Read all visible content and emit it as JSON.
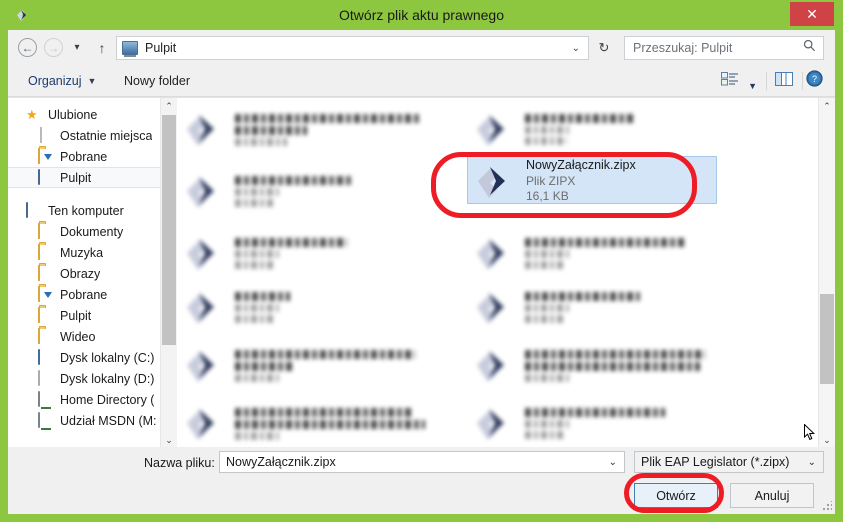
{
  "window": {
    "title": "Otwórz plik aktu prawnego",
    "app_icon": "chevron-logo-icon",
    "close_label": "✕",
    "frame_color": "#8dc63f",
    "close_color": "#cf4245"
  },
  "address_bar": {
    "back_glyph": "←",
    "forward_glyph": "→",
    "history_glyph": "▾",
    "up_glyph": "↑",
    "path": "Pulpit",
    "dropdown_glyph": "⌄",
    "refresh_glyph": "↻"
  },
  "search": {
    "placeholder": "Przeszukaj: Pulpit",
    "icon": "search-icon"
  },
  "toolbar": {
    "organize_label": "Organizuj",
    "organize_caret": "▼",
    "new_folder_label": "Nowy folder",
    "view_icon": "view-options-icon",
    "view_caret": "▼",
    "preview_pane_icon": "preview-pane-icon",
    "help_icon": "help-icon"
  },
  "sidebar": {
    "groups": [
      {
        "header": "Ulubione",
        "header_icon": "star-icon",
        "items": [
          {
            "label": "Ostatnie miejsca",
            "icon": "recent-places-icon",
            "selected": false
          },
          {
            "label": "Pobrane",
            "icon": "downloads-folder-icon",
            "selected": false
          },
          {
            "label": "Pulpit",
            "icon": "desktop-icon",
            "selected": true
          }
        ]
      },
      {
        "header": "Ten komputer",
        "header_icon": "computer-icon",
        "items": [
          {
            "label": "Dokumenty",
            "icon": "documents-folder-icon",
            "selected": false
          },
          {
            "label": "Muzyka",
            "icon": "music-folder-icon",
            "selected": false
          },
          {
            "label": "Obrazy",
            "icon": "pictures-folder-icon",
            "selected": false
          },
          {
            "label": "Pobrane",
            "icon": "downloads-folder-icon",
            "selected": false
          },
          {
            "label": "Pulpit",
            "icon": "desktop-folder-icon",
            "selected": false
          },
          {
            "label": "Wideo",
            "icon": "video-folder-icon",
            "selected": false
          },
          {
            "label": "Dysk lokalny (C:)",
            "icon": "system-drive-icon",
            "selected": false
          },
          {
            "label": "Dysk lokalny (D:)",
            "icon": "drive-icon",
            "selected": false
          },
          {
            "label": "Home Directory (",
            "icon": "network-drive-icon",
            "selected": false
          },
          {
            "label": "Udział MSDN (M:",
            "icon": "network-drive-icon",
            "selected": false
          }
        ]
      }
    ]
  },
  "file_list": {
    "selected_file": {
      "name": "NowyZałącznik.zipx",
      "type": "Plik ZIPX",
      "size": "16,1 KB",
      "icon": "zipx-file-icon",
      "selected": true,
      "annotated": true
    },
    "redacted_note": "pozostałe pozycje listy są rozmyte / nieczytelne",
    "redacted_items": [
      {
        "icon": "zipx-file-icon",
        "lines": 3,
        "name_width": 185,
        "wrap": true
      },
      {
        "icon": "zipx-file-icon",
        "lines": 3,
        "name_width": 110,
        "wrap": false
      },
      {
        "icon": "zipx-file-icon",
        "lines": 3,
        "name_width": 118,
        "wrap": false
      },
      {
        "icon": "zipx-file-icon",
        "lines": 3,
        "name_width": 55,
        "wrap": false
      },
      {
        "icon": "zipx-file-icon",
        "lines": 3,
        "name_width": 148,
        "wrap": true
      },
      {
        "icon": "zipx-file-icon",
        "lines": 3,
        "name_width": 150,
        "wrap": true
      },
      {
        "icon": "zipx-file-icon",
        "lines": 3,
        "name_width": 115,
        "wrap": false
      },
      {
        "icon": "zipx-file-icon",
        "lines": 3,
        "name_width": 92,
        "wrap": false
      },
      {
        "icon": "zipx-file-icon",
        "lines": 3,
        "name_width": 145,
        "wrap": true
      },
      {
        "icon": "zipx-file-icon",
        "lines": 3,
        "name_width": 140,
        "wrap": false
      }
    ]
  },
  "scrollbars": {
    "up_glyph": "⌃",
    "down_glyph": "⌄"
  },
  "footer": {
    "filename_label": "Nazwa pliku:",
    "filename_value": "NowyZałącznik.zipx",
    "filetype_value": "Plik EAP Legislator (*.zipx)",
    "dropdown_glyph": "⌄",
    "open_button": "Otwórz",
    "cancel_button": "Anuluj",
    "resize_grip": "resize-grip-icon"
  },
  "annotations": {
    "color": "#ee1c25",
    "targets": [
      "selected-file-row",
      "open-button"
    ]
  }
}
